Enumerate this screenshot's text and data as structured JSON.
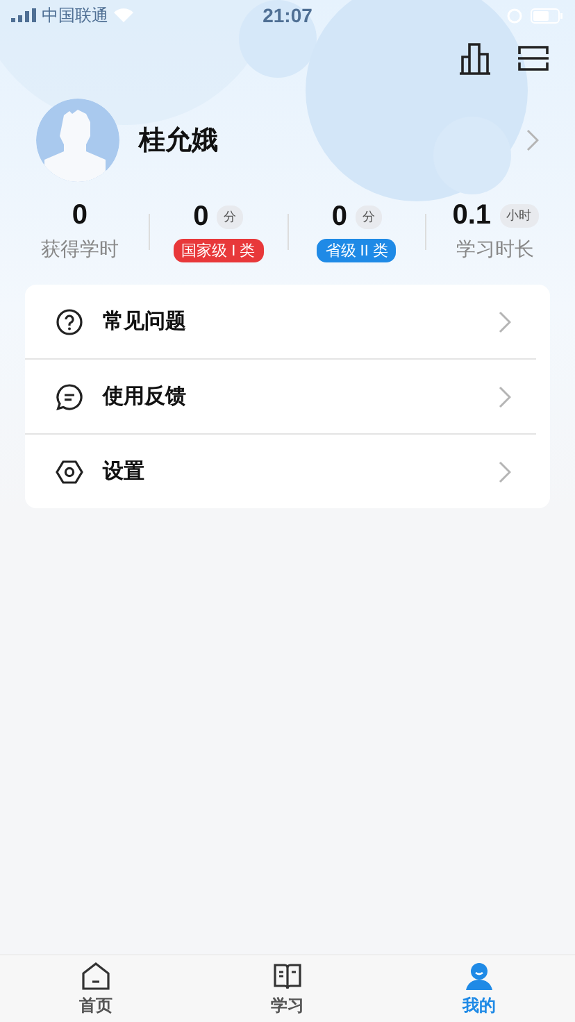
{
  "status_bar": {
    "carrier": "中国联通",
    "time": "21:07"
  },
  "profile": {
    "name": "桂允娥"
  },
  "stats": [
    {
      "value": "0",
      "kind": "plain",
      "label": "获得学时"
    },
    {
      "value": "0",
      "unit": "分",
      "kind": "badge",
      "label": "国家级 I 类",
      "color": "#e8383a"
    },
    {
      "value": "0",
      "unit": "分",
      "kind": "badge",
      "label": "省级 II 类",
      "color": "#1f8ae6"
    },
    {
      "value": "0.1",
      "unit": "小时",
      "kind": "plain",
      "label": "学习时长"
    }
  ],
  "menu": [
    {
      "label": "常见问题"
    },
    {
      "label": "使用反馈"
    },
    {
      "label": "设置"
    }
  ],
  "tabs": [
    {
      "label": "首页",
      "selected": false
    },
    {
      "label": "学习",
      "selected": false
    },
    {
      "label": "我的",
      "selected": true
    }
  ]
}
